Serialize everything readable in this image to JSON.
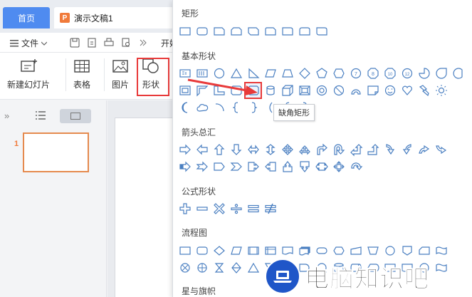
{
  "tabs": {
    "home": "首页",
    "document": "演示文稿1"
  },
  "menubar": {
    "file": "文件",
    "start": "开始"
  },
  "ribbon": {
    "new_slide": "新建幻灯片",
    "table": "表格",
    "picture": "图片",
    "shape": "形状"
  },
  "slides": {
    "current_number": "1"
  },
  "dropdown": {
    "sections": {
      "rect": "矩形",
      "basic": "基本形状",
      "arrows": "箭头总汇",
      "formula": "公式形状",
      "flowchart": "流程图",
      "stars": "星与旗帜"
    },
    "tooltip": "缺角矩形"
  },
  "watermark": {
    "text": "电脑知识吧"
  },
  "colors": {
    "accent": "#4a7fc1",
    "highlight": "#e83a3a",
    "home_tab": "#4f8bf0",
    "doc_icon": "#f07a3a"
  }
}
